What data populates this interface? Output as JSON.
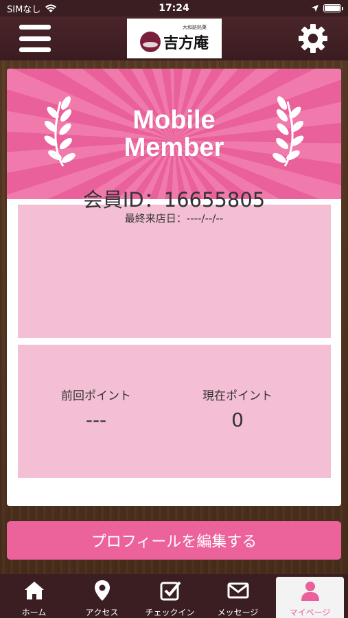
{
  "status_bar": {
    "carrier": "SIMなし",
    "time": "17:24"
  },
  "header": {
    "logo_subtitle": "大和路銘菓",
    "logo_text": "吉方庵"
  },
  "card": {
    "banner_title": "Mobile Member",
    "member_id": "会員ID：16655805",
    "last_visit": "最終来店日：----/--/--",
    "previous_points_label": "前回ポイント",
    "previous_points_value": "---",
    "current_points_label": "現在ポイント",
    "current_points_value": "0"
  },
  "edit_profile_label": "プロフィールを編集する",
  "tabs": [
    {
      "label": "ホーム",
      "icon": "home-icon"
    },
    {
      "label": "アクセス",
      "icon": "map-pin-icon"
    },
    {
      "label": "チェックイン",
      "icon": "checkbox-icon"
    },
    {
      "label": "メッセージ",
      "icon": "envelope-icon"
    },
    {
      "label": "マイページ",
      "icon": "person-icon",
      "active": true
    }
  ],
  "colors": {
    "accent_pink": "#ec639c",
    "panel_pink": "#f4bfd4",
    "header_dark": "#3a1e22"
  }
}
